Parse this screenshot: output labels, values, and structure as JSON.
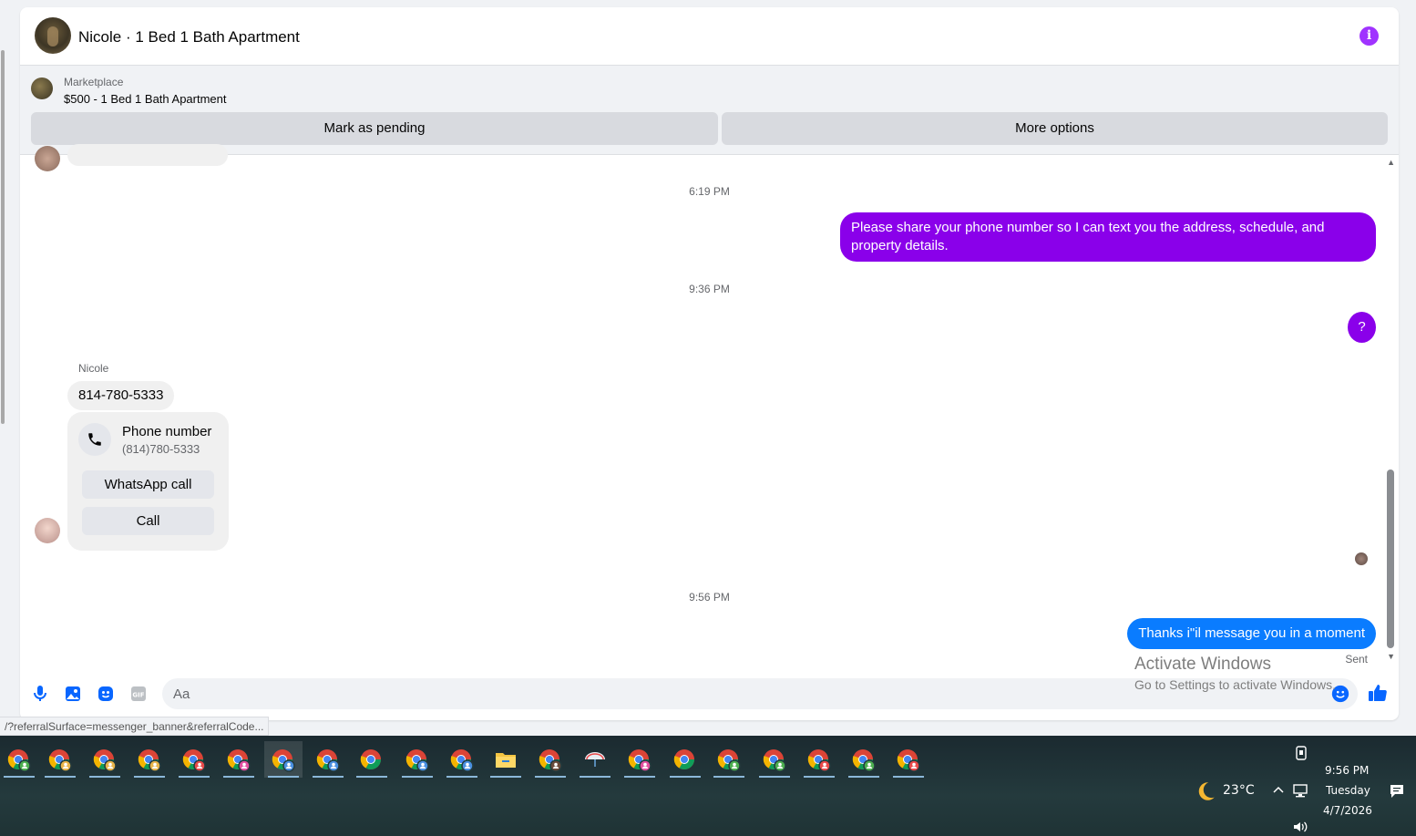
{
  "header": {
    "title": "Nicole · 1 Bed 1 Bath Apartment"
  },
  "marketplace": {
    "label": "Marketplace",
    "listing": "$500 - 1 Bed 1 Bath Apartment",
    "mark_pending": "Mark as pending",
    "more_options": "More options"
  },
  "messages": {
    "ts1": "6:19 PM",
    "out1": "Please share your phone number so I can text you the address, schedule, and property details.",
    "ts2": "9:36 PM",
    "out2": "?",
    "sender": "Nicole",
    "in1": "814-780-5333",
    "card": {
      "title": "Phone number",
      "number": "(814)780-5333",
      "whatsapp": "WhatsApp call",
      "call": "Call"
    },
    "ts3": "9:56 PM",
    "out3": "Thanks i\"il message you in a moment",
    "status": "Sent"
  },
  "composer": {
    "placeholder": "Aa"
  },
  "watermark": {
    "line1": "Activate Windows",
    "line2": "Go to Settings to activate Windows."
  },
  "status_url": "/?referralSurface=messenger_banner&referralCode...",
  "taskbar": {
    "weather": "23°C",
    "time": "9:56 PM",
    "day": "Tuesday",
    "date": "4/7/2026"
  },
  "colors": {
    "purple_bubble": "#8a00ea",
    "blue_bubble": "#0a7cff",
    "accent": "#0866ff"
  }
}
